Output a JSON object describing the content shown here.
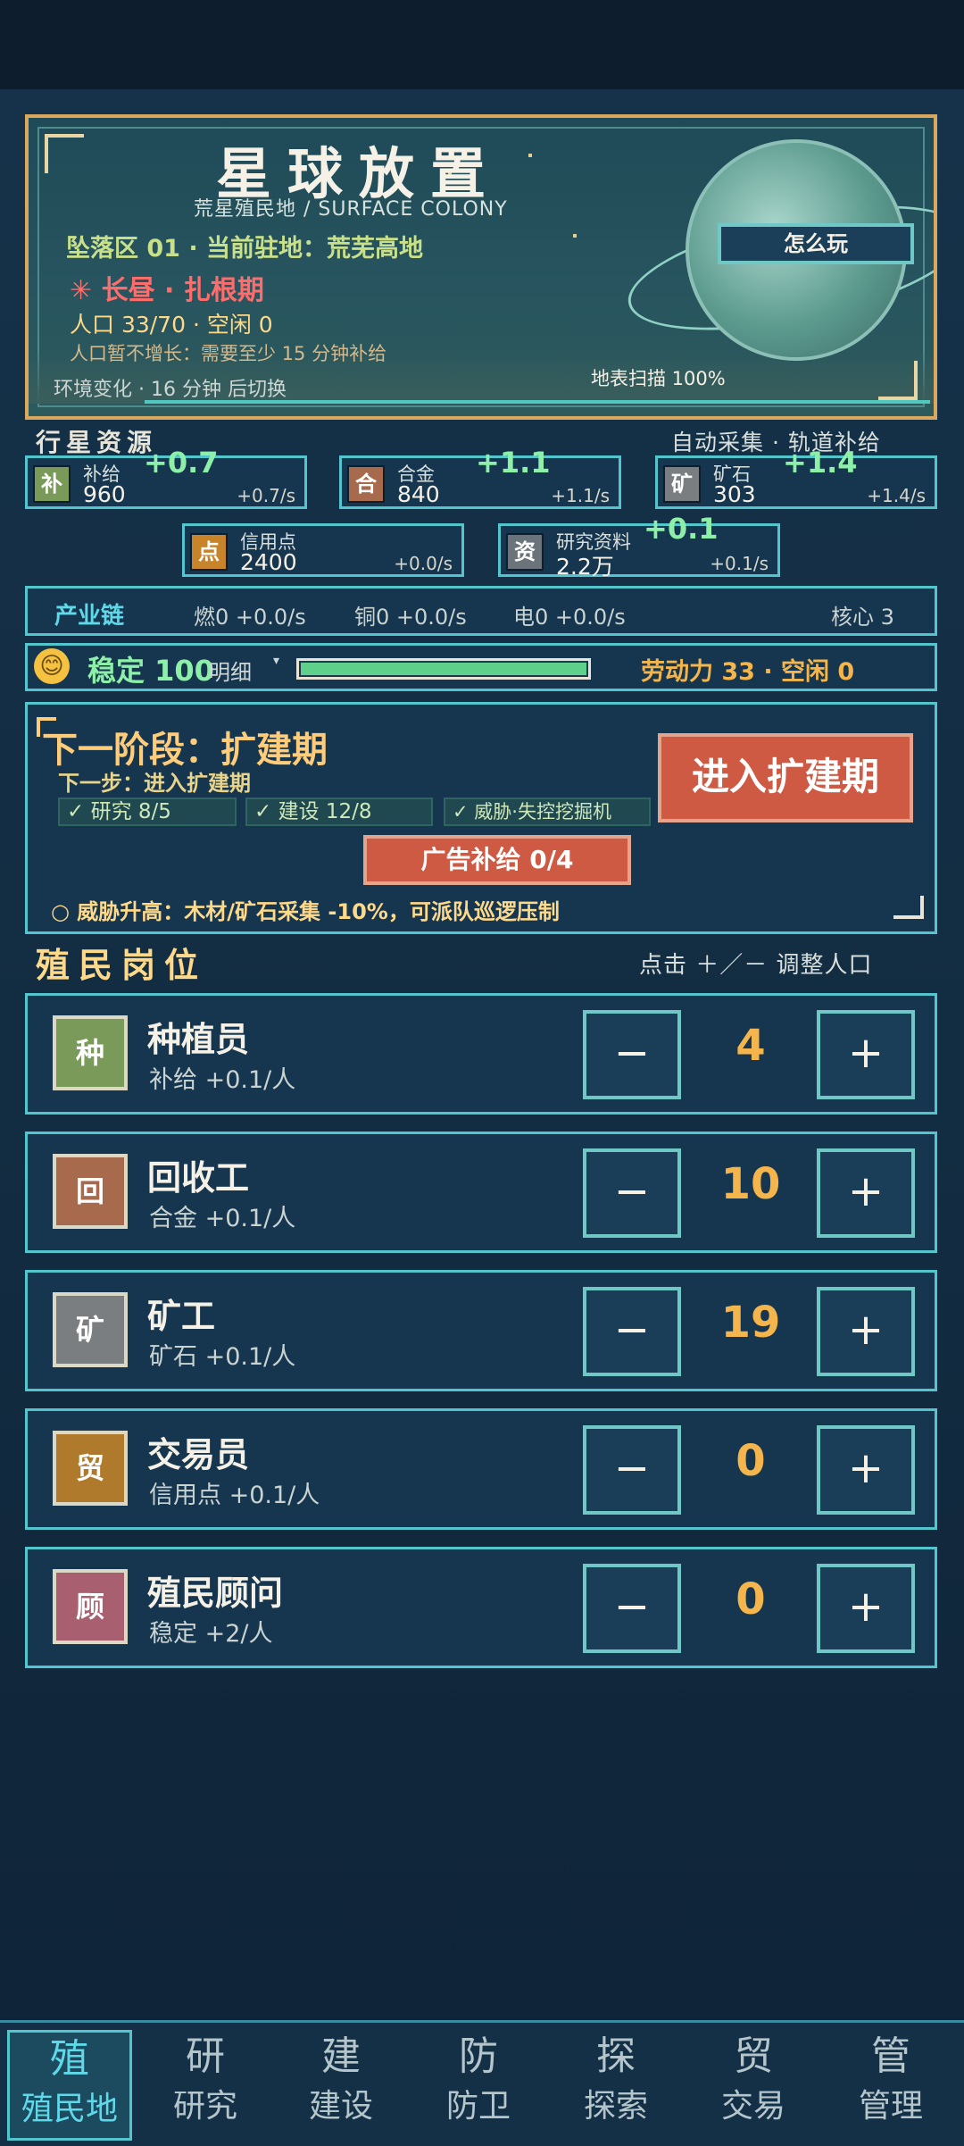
{
  "header": {
    "title": "星球放置",
    "subtitle": "荒星殖民地 / SURFACE COLONY",
    "zone": "坠落区 01 · 当前驻地：荒芜高地",
    "era": "✳ 长昼 · 扎根期",
    "population": "人口 33/70 · 空闲 0",
    "pop_note": "人口暂不增长：需要至少 15 分钟补给",
    "env_change": "环境变化 · 16 分钟 后切换",
    "scan": "地表扫描 100%",
    "how_to_play": "怎么玩"
  },
  "resources": {
    "label": "行星资源",
    "auto_note": "自动采集 · 轨道补给",
    "items": [
      {
        "icon": "补",
        "name": "补给",
        "value": "960",
        "rate": "+0.7/s",
        "float": "+0.7",
        "color": "#7a9a5a"
      },
      {
        "icon": "合",
        "name": "合金",
        "value": "840",
        "rate": "+1.1/s",
        "float": "+1.1",
        "color": "#a86a4c"
      },
      {
        "icon": "矿",
        "name": "矿石",
        "value": "303",
        "rate": "+1.4/s",
        "float": "+1.4",
        "color": "#7a7e80"
      },
      {
        "icon": "点",
        "name": "信用点",
        "value": "2400",
        "rate": "+0.0/s",
        "float": "",
        "color": "#c8842a"
      },
      {
        "icon": "资",
        "name": "研究资料",
        "value": "2.2万",
        "rate": "+0.1/s",
        "float": "+0.1",
        "color": "#6a747a"
      }
    ]
  },
  "industry": {
    "label": "产业链",
    "items": [
      "燃0 +0.0/s",
      "铜0 +0.0/s",
      "电0 +0.0/s"
    ],
    "core": "核心 3"
  },
  "stability": {
    "face": "😊",
    "label": "稳定 100",
    "detail": "明细",
    "level": 1.0,
    "workforce": "劳动力 33 · 空闲 0"
  },
  "next_stage": {
    "title": "下一阶段：扩建期",
    "step": "下一步：进入扩建期",
    "checks": [
      "✓ 研究 8/5",
      "✓ 建设 12/8",
      "✓ 威胁·失控挖掘机"
    ],
    "enter_button": "进入扩建期",
    "ad_button": "广告补给 0/4",
    "threat": "○ 威胁升高：木材/矿石采集 -10%，可派队巡逻压制"
  },
  "jobs": {
    "label": "殖民岗位",
    "hint": "点击 ＋／－ 调整人口",
    "items": [
      {
        "icon": "种",
        "name": "种植员",
        "desc": "补给 +0.1/人",
        "count": "4",
        "color": "#7a9a5a"
      },
      {
        "icon": "回",
        "name": "回收工",
        "desc": "合金 +0.1/人",
        "count": "10",
        "color": "#a86a4c"
      },
      {
        "icon": "矿",
        "name": "矿工",
        "desc": "矿石 +0.1/人",
        "count": "19",
        "color": "#7a7e80"
      },
      {
        "icon": "贸",
        "name": "交易员",
        "desc": "信用点 +0.1/人",
        "count": "0",
        "color": "#b07a2c"
      },
      {
        "icon": "顾",
        "name": "殖民顾问",
        "desc": "稳定 +2/人",
        "count": "0",
        "color": "#a86070"
      }
    ],
    "minus": "−",
    "plus": "+"
  },
  "nav": [
    {
      "glyph": "殖",
      "label": "殖民地",
      "active": true
    },
    {
      "glyph": "研",
      "label": "研究"
    },
    {
      "glyph": "建",
      "label": "建设"
    },
    {
      "glyph": "防",
      "label": "防卫"
    },
    {
      "glyph": "探",
      "label": "探索"
    },
    {
      "glyph": "贸",
      "label": "交易"
    },
    {
      "glyph": "管",
      "label": "管理"
    }
  ]
}
